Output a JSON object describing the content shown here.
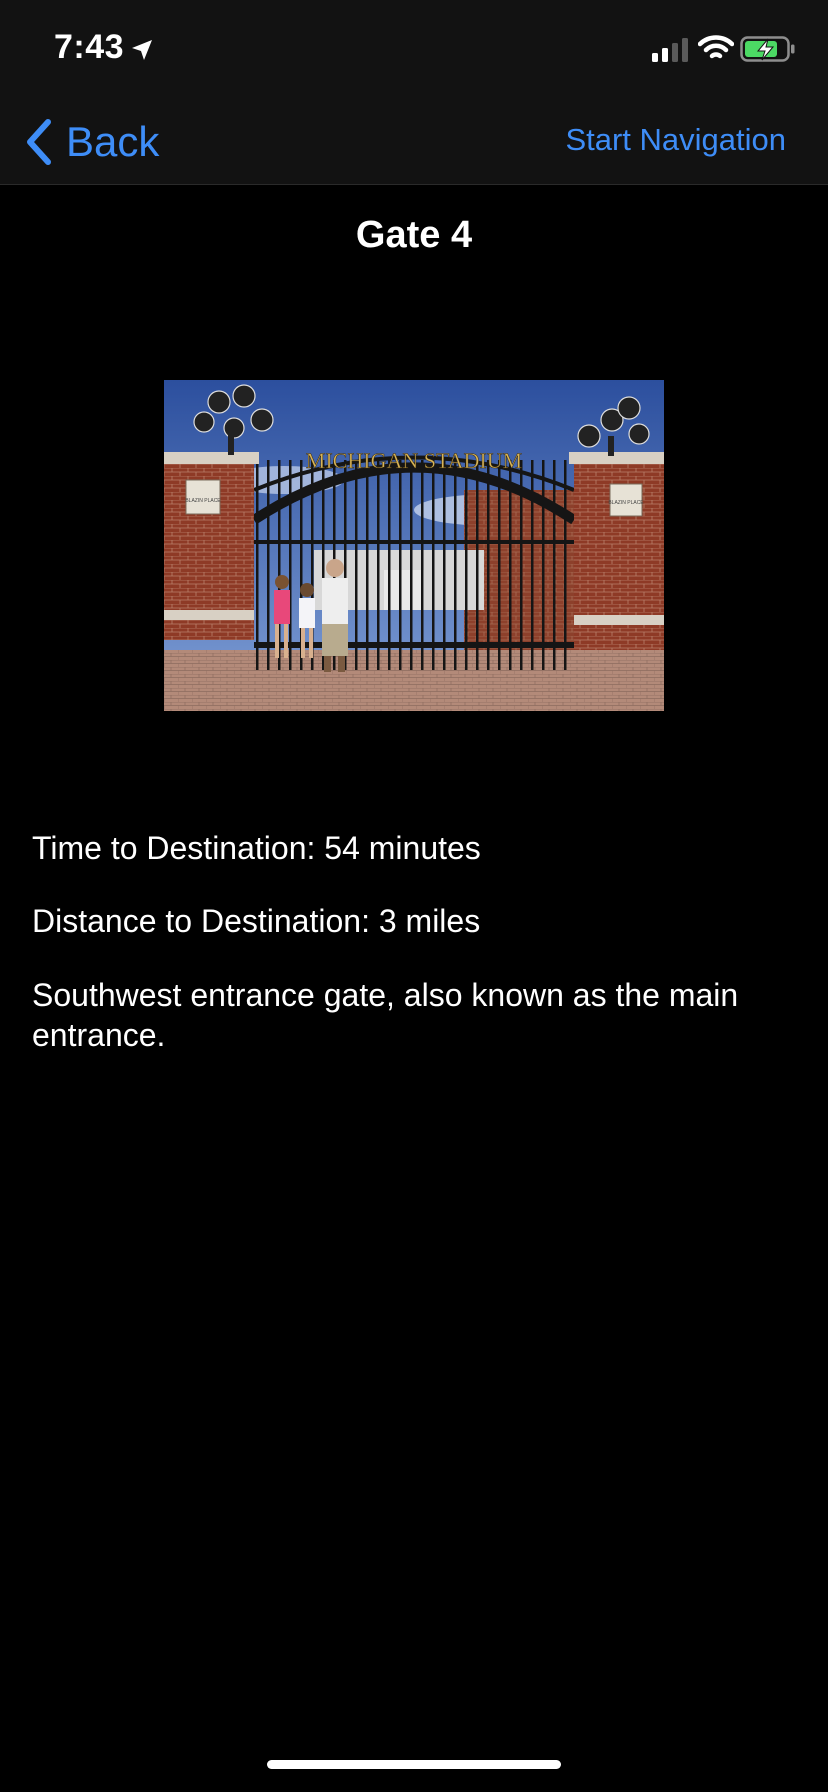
{
  "status_bar": {
    "time": "7:43",
    "icons": [
      "location-arrow-icon",
      "cellular-signal-icon",
      "wifi-icon",
      "battery-charging-icon"
    ]
  },
  "nav": {
    "back_label": "Back",
    "action_label": "Start Navigation"
  },
  "title": "Gate 4",
  "photo": {
    "gate_sign": "MICHIGAN STADIUM",
    "plaque_left": "BLAZIN PLACE",
    "plaque_right": "BLAZIN PLACE"
  },
  "details": {
    "time_to_destination": "Time to Destination: 54 minutes",
    "distance_to_destination": "Distance to Destination: 3 miles",
    "description": "Southwest entrance gate, also known as the main entrance."
  },
  "colors": {
    "accent": "#3e8df7",
    "background": "#000000",
    "bar_background": "#121212",
    "battery_charge": "#4cd964"
  }
}
